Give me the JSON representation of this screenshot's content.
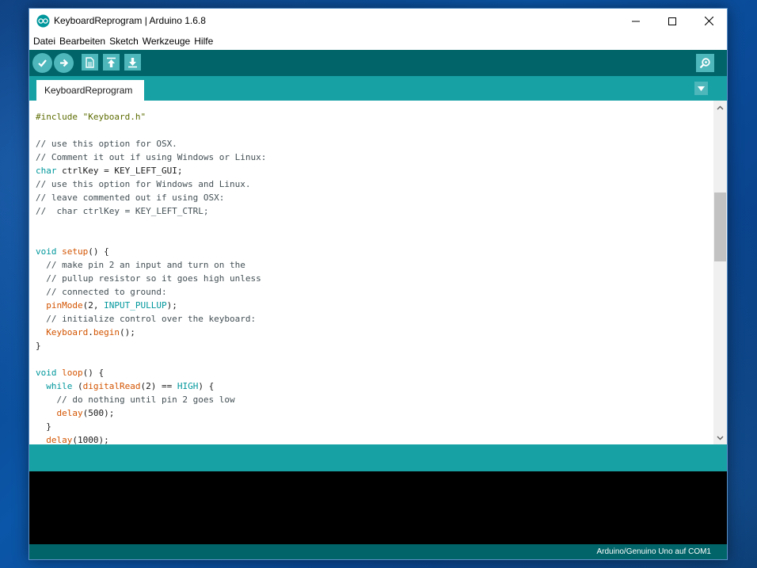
{
  "window": {
    "title": "KeyboardReprogram | Arduino 1.6.8"
  },
  "menu": {
    "items": [
      "Datei",
      "Bearbeiten",
      "Sketch",
      "Werkzeuge",
      "Hilfe"
    ]
  },
  "toolbar": {
    "buttons": [
      {
        "name": "verify",
        "icon": "check-icon"
      },
      {
        "name": "upload",
        "icon": "arrow-right-icon"
      },
      {
        "name": "new",
        "icon": "new-file-icon"
      },
      {
        "name": "open",
        "icon": "open-up-arrow-icon"
      },
      {
        "name": "save",
        "icon": "save-down-arrow-icon"
      },
      {
        "name": "serial-monitor",
        "icon": "magnifier-icon"
      }
    ]
  },
  "tabs": [
    {
      "label": "KeyboardReprogram"
    }
  ],
  "editor": {
    "lines": [
      {
        "segments": [
          {
            "t": "#include \"Keyboard.h\"",
            "c": "pre"
          }
        ]
      },
      {
        "segments": []
      },
      {
        "segments": [
          {
            "t": "// use this option for OSX.",
            "c": "comment"
          }
        ]
      },
      {
        "segments": [
          {
            "t": "// Comment it out if using Windows or Linux:",
            "c": "comment"
          }
        ]
      },
      {
        "segments": [
          {
            "t": "char",
            "c": "kw"
          },
          {
            "t": " ctrlKey = KEY_LEFT_GUI;",
            "c": ""
          }
        ]
      },
      {
        "segments": [
          {
            "t": "// use this option for Windows and Linux.",
            "c": "comment"
          }
        ]
      },
      {
        "segments": [
          {
            "t": "// leave commented out if using OSX:",
            "c": "comment"
          }
        ]
      },
      {
        "segments": [
          {
            "t": "//  char ctrlKey = KEY_LEFT_CTRL;",
            "c": "comment"
          }
        ]
      },
      {
        "segments": []
      },
      {
        "segments": []
      },
      {
        "segments": [
          {
            "t": "void",
            "c": "kw"
          },
          {
            "t": " ",
            "c": ""
          },
          {
            "t": "setup",
            "c": "fn"
          },
          {
            "t": "() {",
            "c": ""
          }
        ]
      },
      {
        "segments": [
          {
            "t": "  // make pin 2 an input and turn on the",
            "c": "comment"
          }
        ]
      },
      {
        "segments": [
          {
            "t": "  // pullup resistor so it goes high unless",
            "c": "comment"
          }
        ]
      },
      {
        "segments": [
          {
            "t": "  // connected to ground:",
            "c": "comment"
          }
        ]
      },
      {
        "segments": [
          {
            "t": "  ",
            "c": ""
          },
          {
            "t": "pinMode",
            "c": "fn"
          },
          {
            "t": "(2, ",
            "c": ""
          },
          {
            "t": "INPUT_PULLUP",
            "c": "const"
          },
          {
            "t": ");",
            "c": ""
          }
        ]
      },
      {
        "segments": [
          {
            "t": "  // initialize control over the keyboard:",
            "c": "comment"
          }
        ]
      },
      {
        "segments": [
          {
            "t": "  ",
            "c": ""
          },
          {
            "t": "Keyboard",
            "c": "fn"
          },
          {
            "t": ".",
            "c": ""
          },
          {
            "t": "begin",
            "c": "fn"
          },
          {
            "t": "();",
            "c": ""
          }
        ]
      },
      {
        "segments": [
          {
            "t": "}",
            "c": ""
          }
        ]
      },
      {
        "segments": []
      },
      {
        "segments": [
          {
            "t": "void",
            "c": "kw"
          },
          {
            "t": " ",
            "c": ""
          },
          {
            "t": "loop",
            "c": "fn"
          },
          {
            "t": "() {",
            "c": ""
          }
        ]
      },
      {
        "segments": [
          {
            "t": "  ",
            "c": ""
          },
          {
            "t": "while",
            "c": "kw"
          },
          {
            "t": " (",
            "c": ""
          },
          {
            "t": "digitalRead",
            "c": "fn"
          },
          {
            "t": "(2) == ",
            "c": ""
          },
          {
            "t": "HIGH",
            "c": "const"
          },
          {
            "t": ") {",
            "c": ""
          }
        ]
      },
      {
        "segments": [
          {
            "t": "    // do nothing until pin 2 goes low",
            "c": "comment"
          }
        ]
      },
      {
        "segments": [
          {
            "t": "    ",
            "c": ""
          },
          {
            "t": "delay",
            "c": "fn"
          },
          {
            "t": "(500);",
            "c": ""
          }
        ]
      },
      {
        "segments": [
          {
            "t": "  }",
            "c": ""
          }
        ]
      },
      {
        "segments": [
          {
            "t": "  ",
            "c": ""
          },
          {
            "t": "delay",
            "c": "fn"
          },
          {
            "t": "(1000);",
            "c": ""
          }
        ]
      }
    ]
  },
  "status": {
    "board": "Arduino/Genuino Uno auf COM1"
  },
  "colors": {
    "toolbar_dark": "#006468",
    "toolbar_light": "#17a1a5",
    "button": "#4db7bb",
    "keyword": "#00979c",
    "function": "#d35400",
    "comment": "#434f54"
  }
}
